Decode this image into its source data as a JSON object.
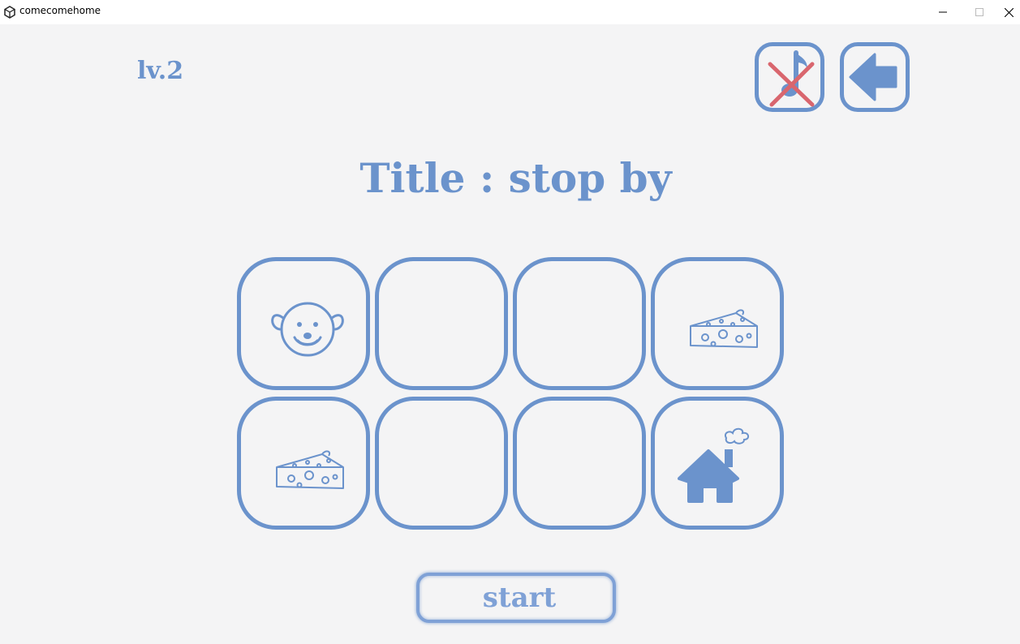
{
  "window": {
    "title": "comecomehome",
    "app_icon": "unity-icon",
    "controls": [
      "minimize-icon",
      "maximize-icon",
      "close-icon"
    ]
  },
  "hud": {
    "level_label": "lv.2",
    "mute_button_icon": "music-note-crossed-icon",
    "back_button_icon": "left-arrow-icon"
  },
  "stage": {
    "title": "Title : stop by"
  },
  "board": {
    "rows": 2,
    "cols": 4,
    "cells": [
      {
        "row": 0,
        "col": 0,
        "content": "mouse-icon"
      },
      {
        "row": 0,
        "col": 1,
        "content": ""
      },
      {
        "row": 0,
        "col": 2,
        "content": ""
      },
      {
        "row": 0,
        "col": 3,
        "content": "cheese-icon"
      },
      {
        "row": 1,
        "col": 0,
        "content": "cheese-icon"
      },
      {
        "row": 1,
        "col": 1,
        "content": ""
      },
      {
        "row": 1,
        "col": 2,
        "content": ""
      },
      {
        "row": 1,
        "col": 3,
        "content": "house-icon"
      }
    ]
  },
  "controls": {
    "start_label": "start"
  },
  "colors": {
    "accent": "#6b93cc",
    "background": "#f4f4f5",
    "mute_cross": "#d9666e"
  }
}
